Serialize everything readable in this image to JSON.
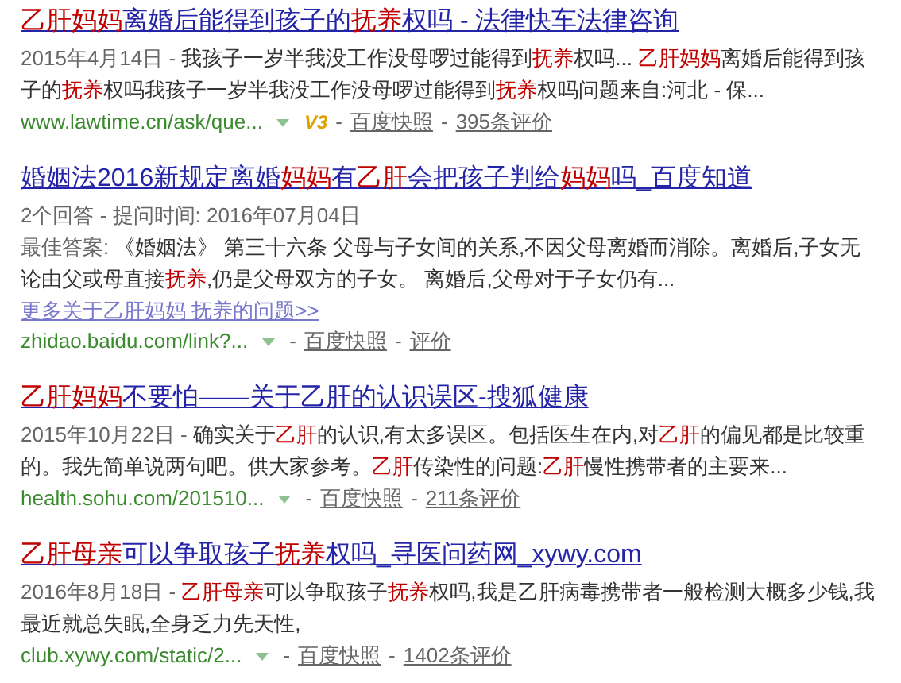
{
  "results": [
    {
      "title": [
        {
          "text": "乙肝妈妈",
          "kind": "match"
        },
        {
          "text": "离婚后能得到孩子的",
          "kind": "text"
        },
        {
          "text": "抚养",
          "kind": "match"
        },
        {
          "text": "权吗 - 法律快车法律咨询",
          "kind": "text"
        }
      ],
      "lines": [
        [
          {
            "text": "2015年4月14日 - ",
            "kind": "meta"
          },
          {
            "text": "我孩子一岁半我没工作没母啰过能得到",
            "kind": "text"
          },
          {
            "text": "抚养",
            "kind": "match"
          },
          {
            "text": "权吗... ",
            "kind": "text"
          },
          {
            "text": "乙肝妈妈",
            "kind": "match"
          },
          {
            "text": "离婚后能得到孩",
            "kind": "text"
          }
        ],
        [
          {
            "text": "子的",
            "kind": "text"
          },
          {
            "text": "抚养",
            "kind": "match"
          },
          {
            "text": "权吗我孩子一岁半我没工作没母啰过能得到",
            "kind": "text"
          },
          {
            "text": "抚养",
            "kind": "match"
          },
          {
            "text": "权吗问题来自:河北 - 保...",
            "kind": "text"
          }
        ]
      ],
      "footer": {
        "url": "www.lawtime.cn/ask/que...",
        "badge": "V3",
        "links": [
          {
            "sep": "-",
            "text": "百度快照"
          },
          {
            "sep": "-",
            "text": "395条评价"
          }
        ]
      }
    },
    {
      "title": [
        {
          "text": "婚姻法2016新规定离婚",
          "kind": "text"
        },
        {
          "text": "妈妈",
          "kind": "match"
        },
        {
          "text": "有",
          "kind": "text"
        },
        {
          "text": "乙肝",
          "kind": "match"
        },
        {
          "text": "会把孩子判给",
          "kind": "text"
        },
        {
          "text": "妈妈",
          "kind": "match"
        },
        {
          "text": "吗_百度知道",
          "kind": "text"
        }
      ],
      "lines": [
        [
          {
            "text": "2个回答 - 提问时间: 2016年07月04日",
            "kind": "meta"
          }
        ],
        [
          {
            "text": "最佳答案: ",
            "kind": "meta"
          },
          {
            "text": "《婚姻法》 第三十六条 父母与子女间的关系,不因父母离婚而消除。离婚后,子女无",
            "kind": "text"
          }
        ],
        [
          {
            "text": "论由父或母直接",
            "kind": "text"
          },
          {
            "text": "抚养",
            "kind": "match"
          },
          {
            "text": ",仍是父母双方的子女。 离婚后,父母对于子女仍有...",
            "kind": "text"
          }
        ]
      ],
      "more": "更多关于乙肝妈妈 抚养的问题>>",
      "footer": {
        "url": "zhidao.baidu.com/link?...",
        "links": [
          {
            "sep": "-",
            "text": "百度快照"
          },
          {
            "sep": "-",
            "text": "评价"
          }
        ]
      }
    },
    {
      "title": [
        {
          "text": "乙肝妈妈",
          "kind": "match"
        },
        {
          "text": "不要怕——关于乙肝的认识误区-搜狐健康",
          "kind": "text"
        }
      ],
      "lines": [
        [
          {
            "text": "2015年10月22日 - ",
            "kind": "meta"
          },
          {
            "text": "确实关于",
            "kind": "text"
          },
          {
            "text": "乙肝",
            "kind": "match"
          },
          {
            "text": "的认识,有太多误区。包括医生在内,对",
            "kind": "text"
          },
          {
            "text": "乙肝",
            "kind": "match"
          },
          {
            "text": "的偏见都是比较重",
            "kind": "text"
          }
        ],
        [
          {
            "text": "的。我先简单说两句吧。供大家参考。",
            "kind": "text"
          },
          {
            "text": "乙肝",
            "kind": "match"
          },
          {
            "text": "传染性的问题:",
            "kind": "text"
          },
          {
            "text": "乙肝",
            "kind": "match"
          },
          {
            "text": "慢性携带者的主要来...",
            "kind": "text"
          }
        ]
      ],
      "footer": {
        "url": "health.sohu.com/201510...",
        "links": [
          {
            "sep": "-",
            "text": "百度快照"
          },
          {
            "sep": "-",
            "text": "211条评价"
          }
        ]
      }
    },
    {
      "title": [
        {
          "text": "乙肝母亲",
          "kind": "match"
        },
        {
          "text": "可以争取孩子",
          "kind": "text"
        },
        {
          "text": "抚养",
          "kind": "match"
        },
        {
          "text": "权吗_寻医问药网_xywy.com",
          "kind": "text"
        }
      ],
      "lines": [
        [
          {
            "text": "2016年8月18日 - ",
            "kind": "meta"
          },
          {
            "text": "乙肝母亲",
            "kind": "match"
          },
          {
            "text": "可以争取孩子",
            "kind": "text"
          },
          {
            "text": "抚养",
            "kind": "match"
          },
          {
            "text": "权吗,我是乙肝病毒携带者一般检测大概多少钱,我",
            "kind": "text"
          }
        ],
        [
          {
            "text": "最近就总失眠,全身乏力先天性,",
            "kind": "text"
          }
        ]
      ],
      "footer": {
        "url": "club.xywy.com/static/2...",
        "links": [
          {
            "sep": "-",
            "text": "百度快照"
          },
          {
            "sep": "-",
            "text": "1402条评价"
          }
        ]
      }
    }
  ]
}
